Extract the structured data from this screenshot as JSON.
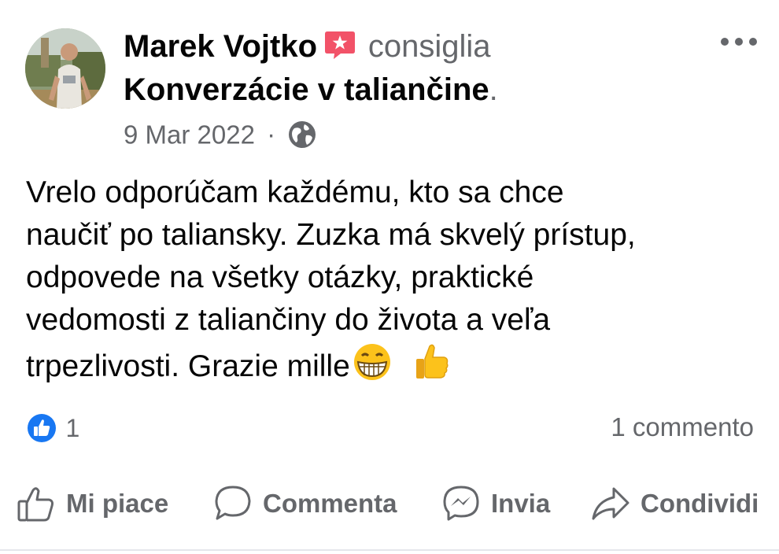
{
  "post": {
    "author": "Marek Vojtko",
    "verb": "consiglia",
    "group": "Konverzácie v taliančine",
    "group_suffix": ".",
    "date": "9 Mar 2022",
    "date_separator": "·",
    "audience_icon": "globe-icon",
    "badge_icon": "recommend-star-icon",
    "text_lines": [
      "Vrelo odporúčam každému, kto sa chce",
      "naučiť po taliansky. Zuzka má skvelý prístup,",
      "odpovede na všetky otázky, praktické",
      "vedomosti z taliančiny do života a veľa",
      "trpezlivosti. Grazie mille"
    ],
    "text_emojis": [
      "grinning-face-emoji",
      "thumbs-up-emoji"
    ]
  },
  "reactions": {
    "icon": "like-reaction-icon",
    "count": "1"
  },
  "comments": {
    "count_label": "1 commento"
  },
  "actions": [
    {
      "label": "Mi piace",
      "icon": "like-icon"
    },
    {
      "label": "Commenta",
      "icon": "comment-icon"
    },
    {
      "label": "Invia",
      "icon": "messenger-icon"
    },
    {
      "label": "Condividi",
      "icon": "share-icon"
    }
  ],
  "colors": {
    "text_primary": "#050505",
    "text_secondary": "#65676b",
    "like_blue": "#1877f2",
    "badge_red": "#f25268"
  }
}
